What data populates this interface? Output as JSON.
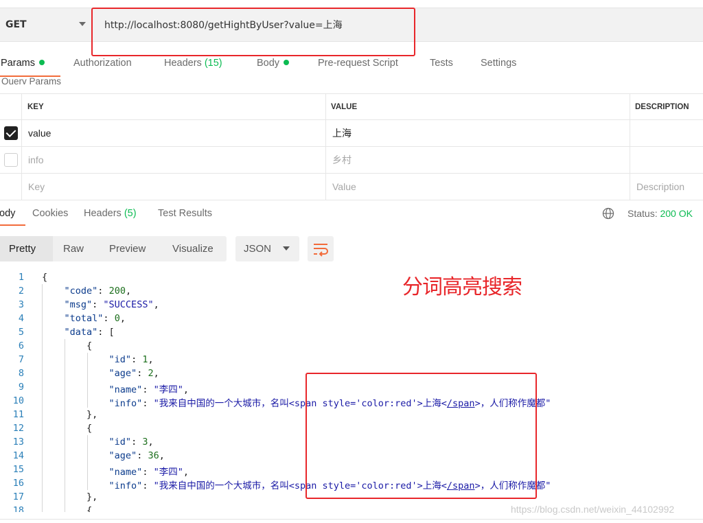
{
  "request": {
    "method": "GET",
    "url": "http://localhost:8080/getHightByUser?value=上海"
  },
  "tabs": {
    "params": "Params",
    "authorization": "Authorization",
    "headers": "Headers",
    "headers_count": "(15)",
    "body": "Body",
    "prerequest": "Pre-request Script",
    "tests": "Tests",
    "settings": "Settings"
  },
  "query_label": "Query Params",
  "params_table": {
    "headers": {
      "key": "KEY",
      "value": "VALUE",
      "description": "DESCRIPTION"
    },
    "rows": [
      {
        "checked": true,
        "key": "value",
        "value": "上海",
        "description": ""
      },
      {
        "checked": false,
        "key": "info",
        "value": "乡村",
        "description": ""
      }
    ],
    "placeholder": {
      "key": "Key",
      "value": "Value",
      "description": "Description"
    }
  },
  "response_tabs": {
    "body": "ody",
    "cookies": "Cookies",
    "headers": "Headers",
    "headers_count": "(5)",
    "test_results": "Test Results"
  },
  "status": {
    "label": "Status:",
    "value": "200 OK"
  },
  "format": {
    "pretty": "Pretty",
    "raw": "Raw",
    "preview": "Preview",
    "visualize": "Visualize",
    "language": "JSON"
  },
  "annotation": "分词高亮搜索",
  "watermark": "https://blog.csdn.net/weixin_44102992",
  "code": {
    "line_numbers": [
      "1",
      "2",
      "3",
      "4",
      "5",
      "6",
      "7",
      "8",
      "9",
      "10",
      "11",
      "12",
      "13",
      "14",
      "15",
      "16",
      "17",
      "18"
    ],
    "code_key": "\"code\"",
    "code_val": "200",
    "msg_key": "\"msg\"",
    "msg_val": "\"SUCCESS\"",
    "total_key": "\"total\"",
    "total_val": "0",
    "data_key": "\"data\"",
    "id_key": "\"id\"",
    "age_key": "\"age\"",
    "name_key": "\"name\"",
    "info_key": "\"info\"",
    "item1": {
      "id": "1",
      "age": "2",
      "name": "\"李四\""
    },
    "item2": {
      "id": "3",
      "age": "36",
      "name": "\"李四\""
    },
    "info_prefix": "\"我来自中国的一个大城市，名叫<span style='color:red'>上海<",
    "info_tag": "/span",
    "info_suffix": ">，人们称作魔都\""
  }
}
